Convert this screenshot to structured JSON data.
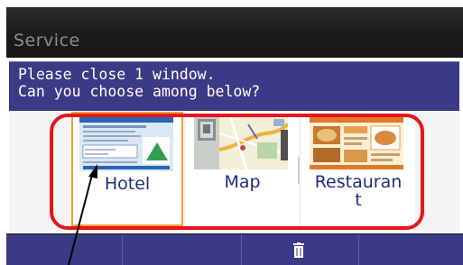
{
  "title_bar": {
    "title": "Service"
  },
  "dialog": {
    "message_line1": "Please close 1 window.",
    "message_line2": "Can you choose among below?"
  },
  "choices": [
    {
      "label": "Hotel",
      "selected": true
    },
    {
      "label": "Map",
      "selected": false
    },
    {
      "label_line1": "Restauran",
      "label_line2": "t",
      "selected": false
    }
  ],
  "bottom_bar": {
    "icon": "trash-icon"
  },
  "colors": {
    "dialog_header": "#3b3a86",
    "highlight_frame": "#e8141e",
    "selected_border": "#f0a030",
    "label_text": "#1e2d80"
  }
}
